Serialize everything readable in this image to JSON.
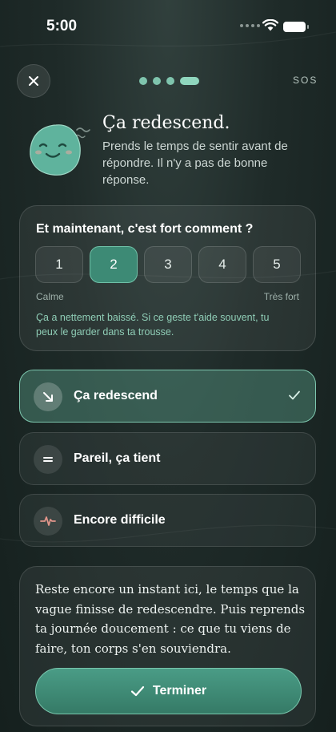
{
  "status_bar": {
    "time": "5:00"
  },
  "nav": {
    "sos_label": "SOS",
    "progress_steps": 4,
    "current_step": 4
  },
  "header": {
    "title": "Ça redescend.",
    "subtitle": "Prends le temps de sentir avant de répondre. Il n'y a pas de bonne réponse."
  },
  "intensity": {
    "question": "Et maintenant, c'est fort comment ?",
    "options": [
      "1",
      "2",
      "3",
      "4",
      "5"
    ],
    "selected": "2",
    "min_label": "Calme",
    "max_label": "Très fort",
    "feedback": "Ça a nettement baissé. Si ce geste t'aide souvent, tu peux le garder dans ta trousse."
  },
  "choices": [
    {
      "label": "Ça redescend",
      "icon": "arrow-down-right-icon",
      "selected": true
    },
    {
      "label": "Pareil, ça tient",
      "icon": "equals-icon",
      "selected": false
    },
    {
      "label": "Encore difficile",
      "icon": "pulse-icon",
      "selected": false
    }
  ],
  "closing": {
    "message": "Reste encore un instant ici, le temps que la vague finisse de redescendre. Puis reprends ta journée doucement : ce que tu viens de faire, ton corps s'en souviendra.",
    "button_label": "Terminer"
  },
  "colors": {
    "accent": "#3d8a75",
    "accent_light": "#8fd6bd",
    "background": "#1f2b29",
    "mascot": "#5fb39d"
  }
}
